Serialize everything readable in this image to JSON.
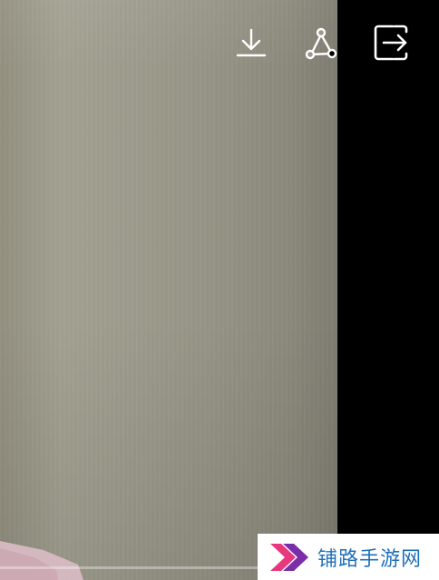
{
  "player": {
    "toolbar": {
      "icons": [
        "download-icon",
        "share-icon",
        "exit-icon"
      ],
      "icon_color": "#ffffff"
    },
    "progress": {
      "played_fraction": 0.0
    },
    "frame_colors": {
      "scene": "#9b998a",
      "letterbox": "#000000",
      "pink_tint": "#d8b6bf"
    }
  },
  "watermark": {
    "text": "铺路手游网",
    "text_color": "#1f6fb8",
    "logo_colors": [
      "#e8377d",
      "#7a2fa8"
    ]
  }
}
